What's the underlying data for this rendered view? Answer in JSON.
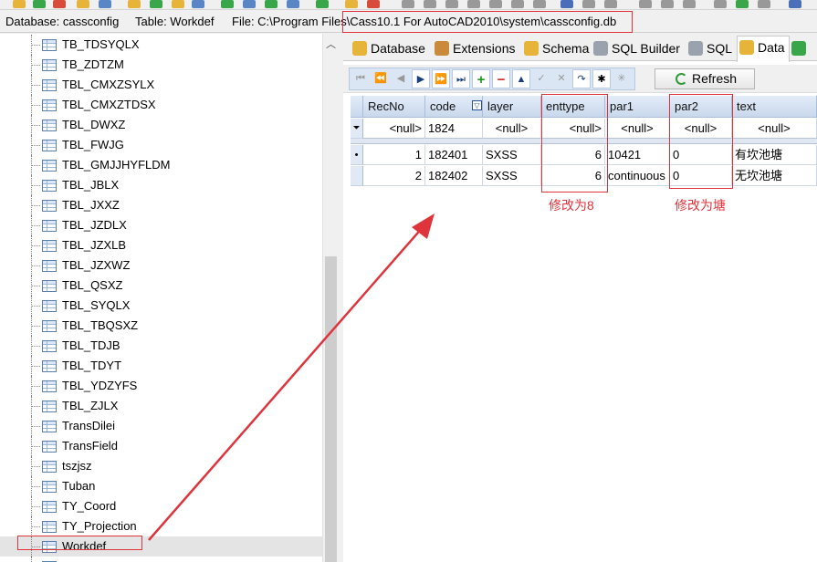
{
  "info_bar": {
    "database": "Database: cassconfig",
    "table": "Table: Workdef",
    "file": "File: C:\\Program Files\\Cass10.1 For AutoCAD2010\\system\\cassconfig.db"
  },
  "tree": {
    "items": [
      {
        "label": "TB_TDSYQLX"
      },
      {
        "label": "TB_ZDTZM"
      },
      {
        "label": "TBL_CMXZSYLX"
      },
      {
        "label": "TBL_CMXZTDSX"
      },
      {
        "label": "TBL_DWXZ"
      },
      {
        "label": "TBL_FWJG"
      },
      {
        "label": "TBL_GMJJHYFLDM"
      },
      {
        "label": "TBL_JBLX"
      },
      {
        "label": "TBL_JXXZ"
      },
      {
        "label": "TBL_JZDLX"
      },
      {
        "label": "TBL_JZXLB"
      },
      {
        "label": "TBL_JZXWZ"
      },
      {
        "label": "TBL_QSXZ"
      },
      {
        "label": "TBL_SYQLX"
      },
      {
        "label": "TBL_TBQSXZ"
      },
      {
        "label": "TBL_TDJB"
      },
      {
        "label": "TBL_TDYT"
      },
      {
        "label": "TBL_YDZYFS"
      },
      {
        "label": "TBL_ZJLX"
      },
      {
        "label": "TransDilei"
      },
      {
        "label": "TransField"
      },
      {
        "label": "tszjsz"
      },
      {
        "label": "Tuban"
      },
      {
        "label": "TY_Coord"
      },
      {
        "label": "TY_Projection"
      },
      {
        "label": "Workdef",
        "selected": true
      },
      {
        "label": "ZD_SYQ"
      }
    ]
  },
  "tabs": [
    {
      "label": "Database",
      "icon": "database-icon"
    },
    {
      "label": "Extensions",
      "icon": "extensions-icon"
    },
    {
      "label": "Schema",
      "icon": "schema-icon"
    },
    {
      "label": "SQL Builder",
      "icon": "sql-builder-icon"
    },
    {
      "label": "SQL",
      "icon": "sql-icon"
    },
    {
      "label": "Data",
      "icon": "data-icon",
      "active": true
    }
  ],
  "toolbar": {
    "refresh_label": "Refresh"
  },
  "grid": {
    "columns": [
      "RecNo",
      "code",
      "layer",
      "enttype",
      "par1",
      "par2",
      "text"
    ],
    "filter_row": [
      "<null>",
      "1824",
      "<null>",
      "<null>",
      "<null>",
      "<null>",
      "<null>"
    ],
    "rows": [
      [
        "1",
        "182401",
        "SXSS",
        "6",
        "10421",
        "0",
        "有坎池塘"
      ],
      [
        "2",
        "182402",
        "SXSS",
        "6",
        "continuous",
        "0",
        "无坎池塘"
      ]
    ]
  },
  "annotations": {
    "enttype_note": "修改为8",
    "par2_note": "修改为塘"
  },
  "colors": {
    "annotation_red": "#e0343c",
    "header_blue": "#c9d8ec",
    "selected_gray": "#e4e4e4"
  }
}
